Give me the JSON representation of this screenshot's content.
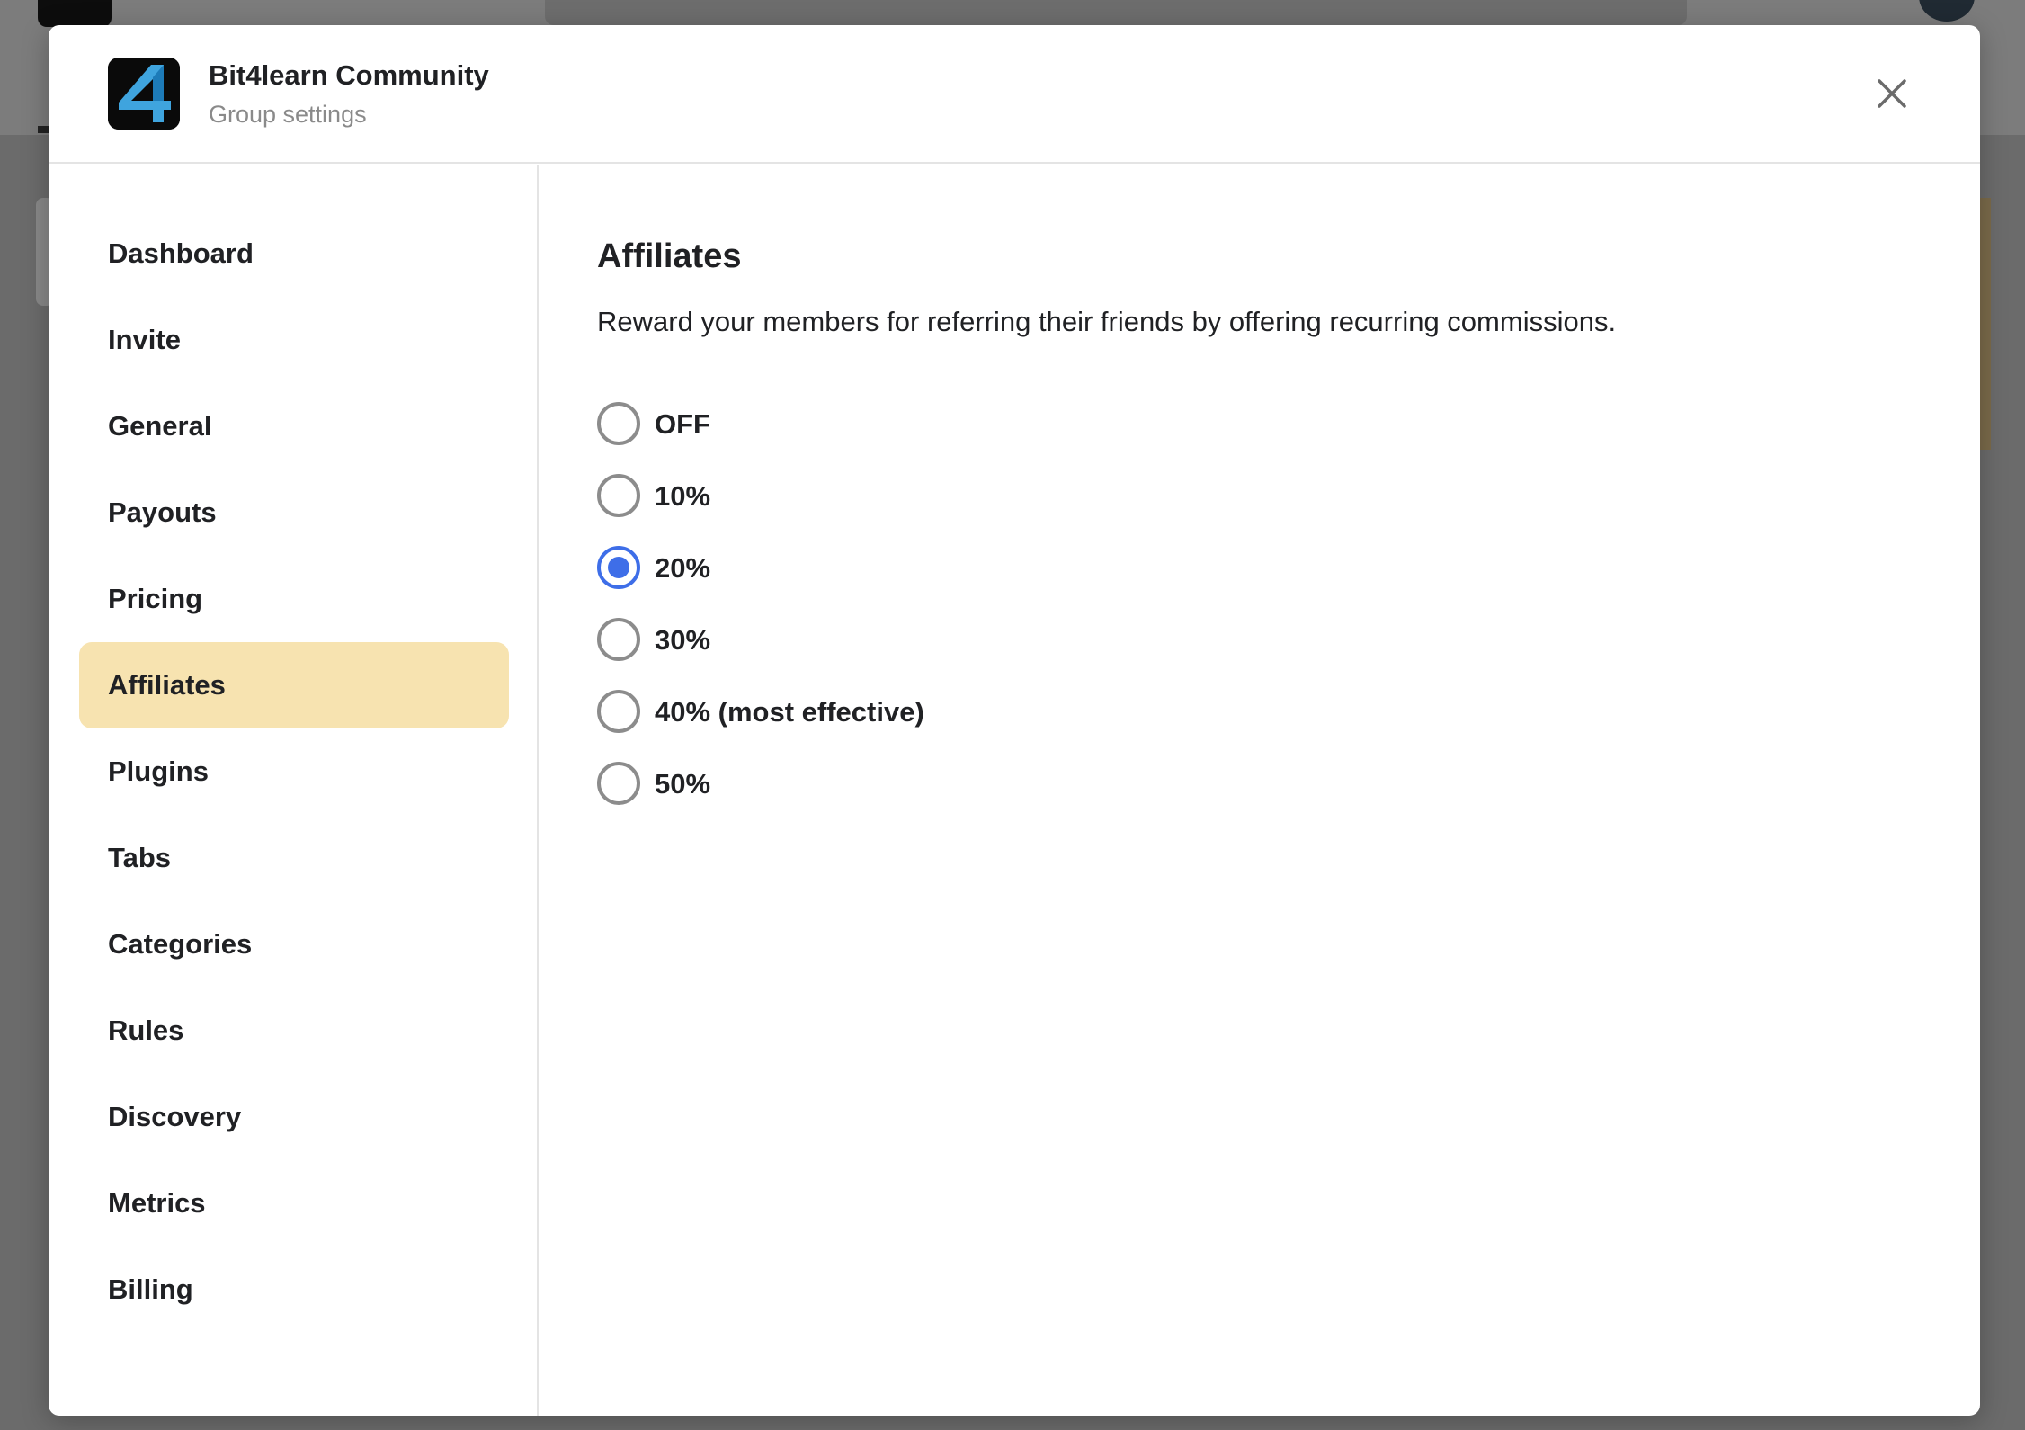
{
  "colors": {
    "accent": "#3e6ee8",
    "active_nav_bg": "#f7e3b0",
    "overlay": "#6b6b6b"
  },
  "modal": {
    "group_name": "Bit4learn Community",
    "subtitle": "Group settings",
    "logo_icon": "bit4learn-logo",
    "close_icon": "close-icon"
  },
  "sidebar": {
    "active": "Affiliates",
    "items": [
      {
        "label": "Dashboard"
      },
      {
        "label": "Invite"
      },
      {
        "label": "General"
      },
      {
        "label": "Payouts"
      },
      {
        "label": "Pricing"
      },
      {
        "label": "Affiliates"
      },
      {
        "label": "Plugins"
      },
      {
        "label": "Tabs"
      },
      {
        "label": "Categories"
      },
      {
        "label": "Rules"
      },
      {
        "label": "Discovery"
      },
      {
        "label": "Metrics"
      },
      {
        "label": "Billing"
      }
    ]
  },
  "content": {
    "title": "Affiliates",
    "description": "Reward your members for referring their friends by offering recurring commissions.",
    "selected": "20%",
    "options": [
      {
        "label": "OFF"
      },
      {
        "label": "10%"
      },
      {
        "label": "20%"
      },
      {
        "label": "30%"
      },
      {
        "label": "40% (most effective)"
      },
      {
        "label": "50%"
      }
    ]
  }
}
